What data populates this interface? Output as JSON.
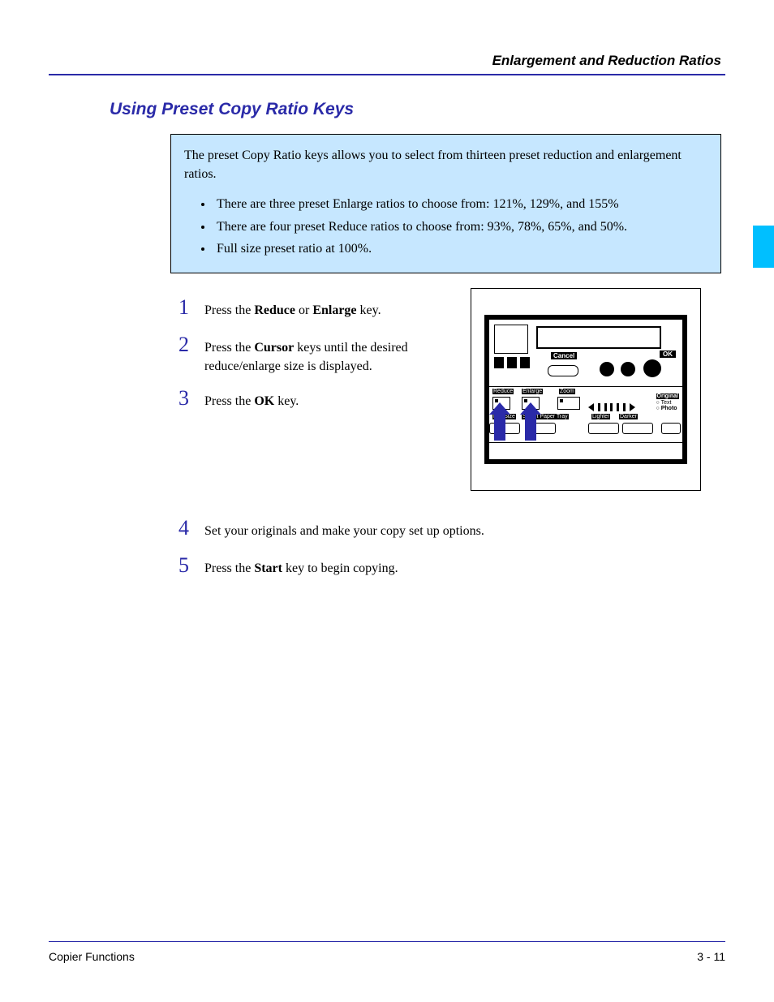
{
  "header": {
    "title": "Enlargement and Reduction Ratios"
  },
  "section": {
    "heading": "Using Preset Copy Ratio Keys"
  },
  "info": {
    "intro": "The preset Copy Ratio keys allows you to select from thirteen preset reduction and enlargement ratios.",
    "bullets": [
      "There are three preset Enlarge ratios to choose from: 121%, 129%, and 155%",
      "There are four preset Reduce ratios to choose from: 93%, 78%, 65%, and 50%.",
      "Full size preset ratio at 100%."
    ]
  },
  "steps": [
    {
      "num": "1",
      "b1": "Reduce",
      "b2": "Enlarge"
    },
    {
      "num": "2",
      "b1": "Cursor"
    },
    {
      "num": "3",
      "b1": "OK"
    },
    {
      "num": "4",
      "text": "Set your originals and make your copy set up options."
    },
    {
      "num": "5",
      "b1": "Start"
    }
  ],
  "panel": {
    "cancel": "Cancel",
    "ok": "OK",
    "reduce": "Reduce",
    "enlarge": "Enlarge",
    "zoom": "Zoom",
    "lighter": "Lighter",
    "darker": "Darker",
    "fullsize": "Full Size",
    "selectpaper": "Select Paper Tray",
    "original": "Original",
    "text": "Text",
    "photo": "Photo"
  },
  "footer": {
    "left": "Copier Functions",
    "right": "3 - 11"
  }
}
